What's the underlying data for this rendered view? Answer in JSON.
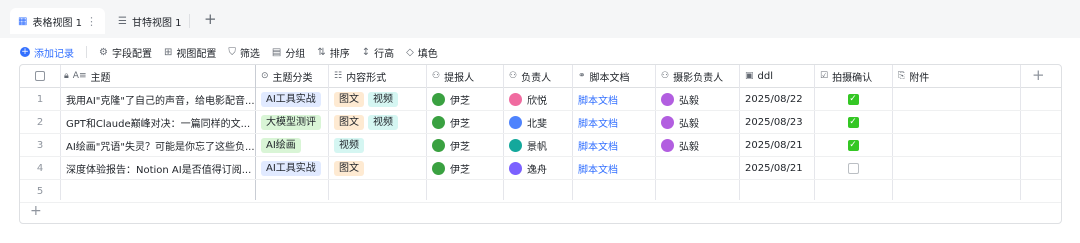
{
  "tabs": [
    {
      "label": "表格视图 1",
      "icon": "grid-icon",
      "active": true
    },
    {
      "label": "甘特视图 1",
      "icon": "gantt-icon",
      "active": false
    }
  ],
  "toolbar": {
    "add_record": "添加记录",
    "field_config": "字段配置",
    "view_config": "视图配置",
    "filter": "筛选",
    "group": "分组",
    "sort": "排序",
    "row_height": "行高",
    "fill": "填色"
  },
  "columns": [
    "主题",
    "主题分类",
    "内容形式",
    "提报人",
    "负责人",
    "脚本文档",
    "摄影负责人",
    "ddl",
    "拍摄确认",
    "附件"
  ],
  "rows": [
    {
      "num": "1",
      "title": "我用AI\"克隆\"了自己的声音，给电影配音...",
      "category": "AI工具实战",
      "category_color": "blue",
      "formats": [
        "图文",
        "视频"
      ],
      "reporter": "伊芝",
      "owner": "欣悦",
      "owner_color": "#f06ba0",
      "script": "脚本文档",
      "photographer": "弘毅",
      "ddl": "2025/08/22",
      "confirmed": true
    },
    {
      "num": "2",
      "title": "GPT和Claude巅峰对决：一篇同样的文...",
      "category": "大模型测评",
      "category_color": "green",
      "formats": [
        "图文",
        "视频"
      ],
      "reporter": "伊芝",
      "owner": "北斐",
      "owner_color": "#4e83fd",
      "script": "脚本文档",
      "photographer": "弘毅",
      "ddl": "2025/08/23",
      "confirmed": true
    },
    {
      "num": "3",
      "title": "AI绘画\"咒语\"失灵？可能是你忘了这些负...",
      "category": "AI绘画",
      "category_color": "green",
      "formats": [
        "视频"
      ],
      "reporter": "伊芝",
      "owner": "景帆",
      "owner_color": "#14a89c",
      "script": "脚本文档",
      "photographer": "弘毅",
      "ddl": "2025/08/21",
      "confirmed": true
    },
    {
      "num": "4",
      "title": "深度体验报告：Notion AI是否值得订阅...",
      "category": "AI工具实战",
      "category_color": "blue",
      "formats": [
        "图文"
      ],
      "reporter": "伊芝",
      "owner": "逸舟",
      "owner_color": "#7b61ff",
      "script": "脚本文档",
      "photographer": "",
      "ddl": "2025/08/21",
      "confirmed": false
    },
    {
      "num": "5",
      "title": "",
      "category": "",
      "category_color": "",
      "formats": [],
      "reporter": "",
      "owner": "",
      "owner_color": "",
      "script": "",
      "photographer": "",
      "ddl": "",
      "confirmed": false
    }
  ],
  "colors": {
    "accent": "#3370ff",
    "check": "#34c724",
    "reporter_avatar": "#3aa141",
    "photographer_avatar": "#b25ee0"
  }
}
